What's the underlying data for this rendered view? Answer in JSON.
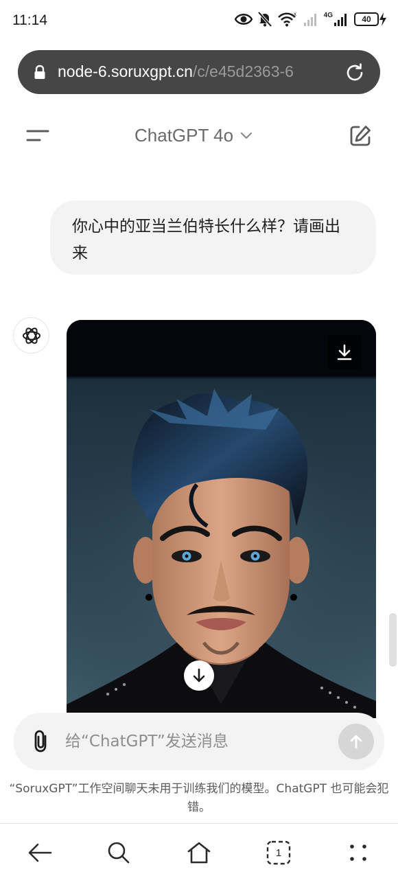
{
  "status_bar": {
    "time": "11:14",
    "network": "4G",
    "battery": "40"
  },
  "url_bar": {
    "host": "node-6.soruxgpt.cn",
    "path": "/c/e45d2363-6"
  },
  "header": {
    "model_name": "ChatGPT 4o"
  },
  "conversation": {
    "user_message": "你心中的亚当兰伯特长什么样？请画出来"
  },
  "composer": {
    "placeholder": "给“ChatGPT”发送消息"
  },
  "disclaimer": "“SoruxGPT”工作空间聊天未用于训练我们的模型。ChatGPT 也可能会犯错。",
  "bottom_nav": {
    "tab_count": "1"
  },
  "icons": {
    "status": [
      "eye-icon",
      "bell-off-icon",
      "wifi-icon",
      "signal-icon",
      "battery-icon"
    ],
    "url": [
      "lock-icon",
      "reload-icon"
    ],
    "header": [
      "menu-icon",
      "new-chat-icon",
      "chevron-down-icon"
    ],
    "nav": [
      "back-arrow-icon",
      "search-icon",
      "home-icon",
      "tabs-icon",
      "more-icon"
    ]
  },
  "colors": {
    "url_bar_bg": "#464646",
    "bubble_bg": "#f3f3f3",
    "send_disabled": "#d6d6d6"
  }
}
